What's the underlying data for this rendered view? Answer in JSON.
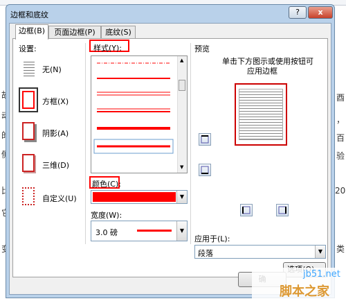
{
  "dialog": {
    "title": "边框和底纹",
    "help_label": "?",
    "close_label": "x",
    "tabs": [
      "边框(B)",
      "页面边框(P)",
      "底纹(S)"
    ],
    "active_tab": 0
  },
  "settings": {
    "label": "设置:",
    "items": [
      "无(N)",
      "方框(X)",
      "阴影(A)",
      "三维(D)",
      "自定义(U)"
    ],
    "selected": "方框(X)"
  },
  "style": {
    "label": "样式(Y):"
  },
  "color": {
    "label": "颜色(C):",
    "value": "#ff0000"
  },
  "width": {
    "label": "宽度(W):",
    "value": "3.0 磅"
  },
  "preview": {
    "label": "预览",
    "hint_line1": "单击下方图示或使用按钮可",
    "hint_line2": "应用边框"
  },
  "apply_to": {
    "label": "应用于(L):",
    "value": "段落"
  },
  "buttons": {
    "options": "选项(O)...",
    "ok": "确"
  },
  "watermark": {
    "site": "jb51.net",
    "brand": "脚本之家"
  },
  "colors": {
    "accent_red": "#ff0000",
    "dialog_frame": "#b9d1ea"
  }
}
